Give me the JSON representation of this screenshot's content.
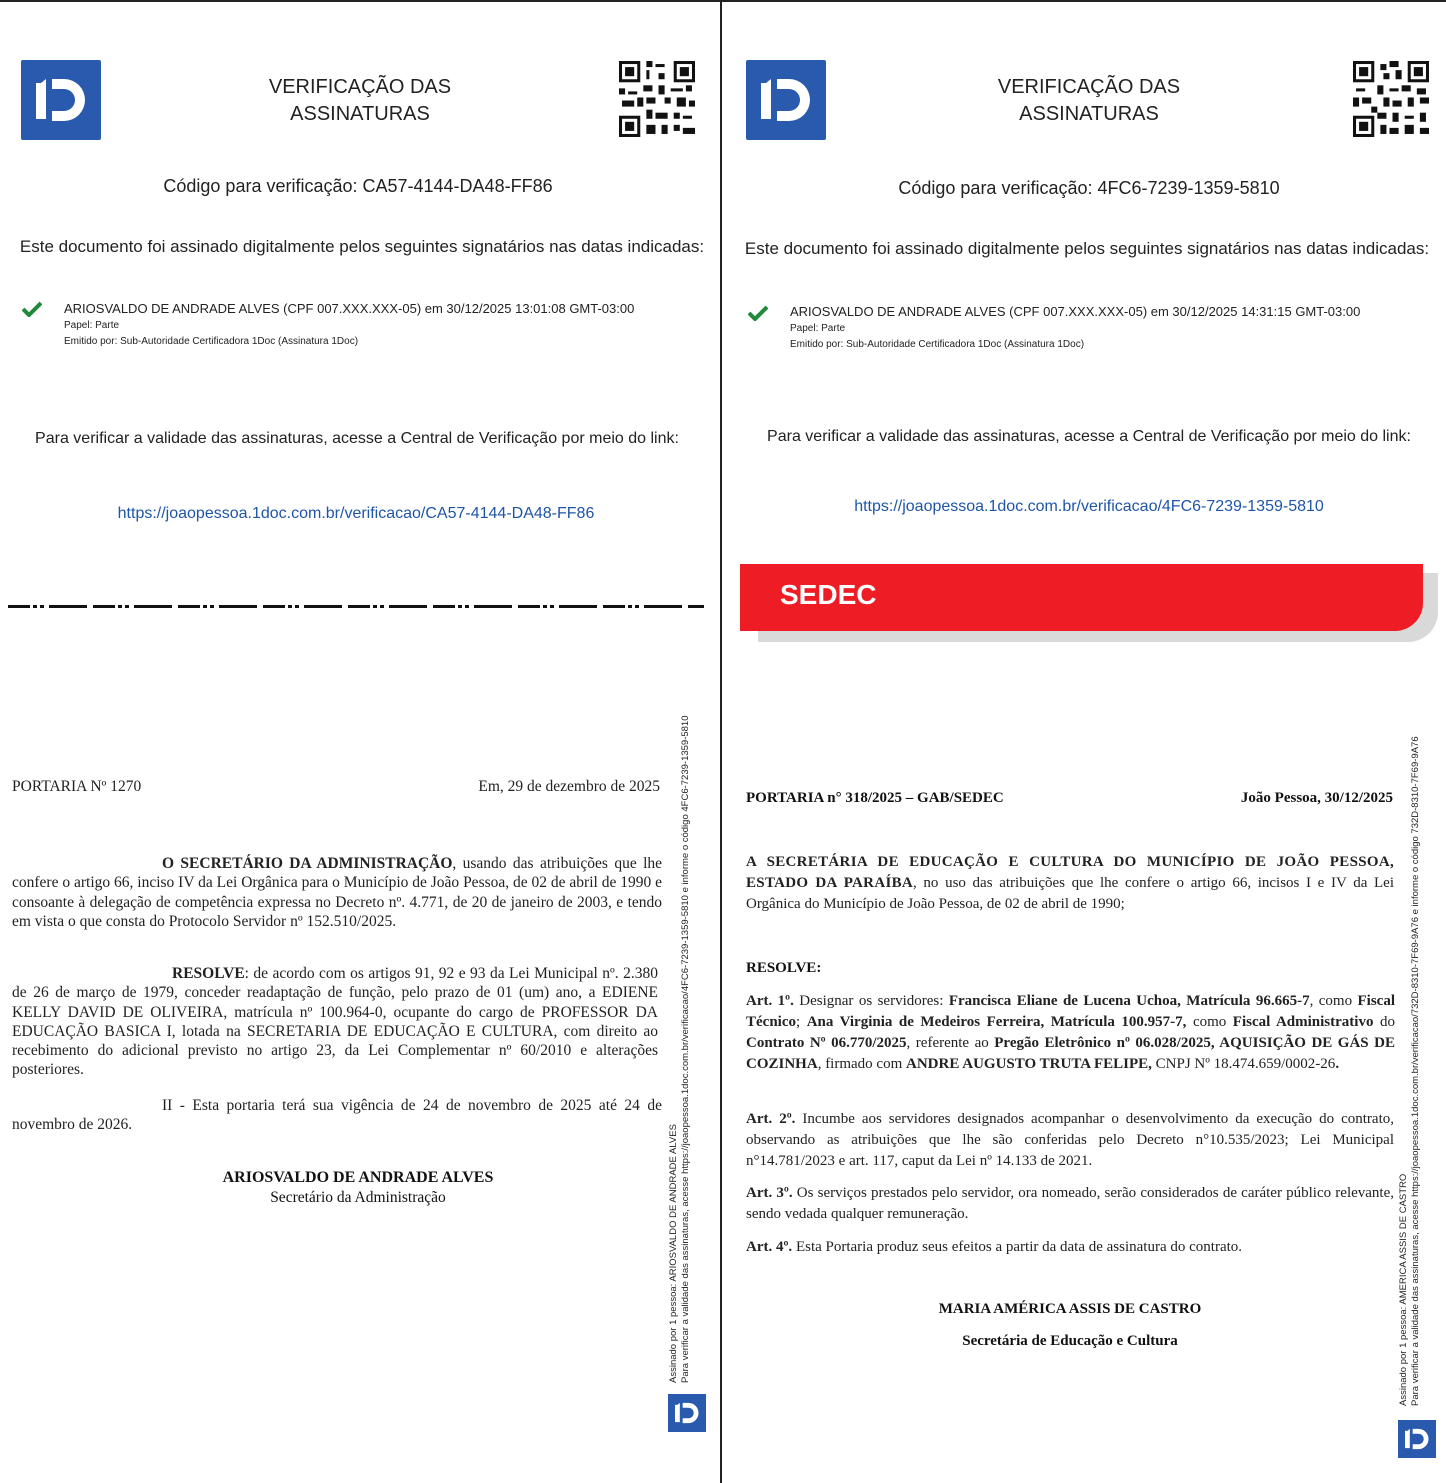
{
  "left": {
    "title_line1": "VERIFICAÇÃO DAS",
    "title_line2": "ASSINATURAS",
    "code_line": "Código para verificação: CA57-4144-DA48-FF86",
    "intro": "Este documento foi assinado digitalmente pelos seguintes signatários nas datas indicadas:",
    "signer": "ARIOSVALDO DE ANDRADE ALVES (CPF 007.XXX.XXX-05) em 30/12/2025 13:01:08 GMT-03:00",
    "role": "Papel: Parte",
    "issuer": "Emitido por: Sub-Autoridade Certificadora 1Doc (Assinatura 1Doc)",
    "verify_text": "Para verificar a validade das assinaturas, acesse a Central de Verificação por meio do link:",
    "link": "https://joaopessoa.1doc.com.br/verificacao/CA57-4144-DA48-FF86",
    "portaria": "PORTARIA Nº 1270",
    "date": "Em, 29 de dezembro de 2025",
    "p1_bold": "O SECRETÁRIO DA ADMINISTRAÇÃO",
    "p1_rest": ", usando das atribuições que lhe confere o artigo 66, inciso IV da Lei Orgânica para o Município de João Pessoa, de 02 de abril de 1990 e consoante à delegação de competência expressa no Decreto nº. 4.771, de 20 de janeiro de 2003, e tendo em vista o que consta do Protocolo Servidor nº 152.510/2025.",
    "p2_bold": "RESOLVE",
    "p2_rest": ": de acordo com os artigos 91, 92 e 93 da Lei Municipal nº. 2.380 de 26 de março de 1979, conceder readaptação de função, pelo prazo de 01 (um) ano, a EDIENE KELLY DAVID DE OLIVEIRA,  matrícula  nº 100.964-0, ocupante do cargo de PROFESSOR DA EDUCAÇÃO BASICA I, lotada na SECRETARIA DE EDUCAÇÃO E CULTURA, com direito ao recebimento do adicional previsto no artigo 23, da Lei Complementar nº 60/2010 e alterações posteriores.",
    "p3": "II - Esta portaria terá sua vigência de 24 de novembro de 2025 até 24 de novembro de 2026.",
    "sign_name": "ARIOSVALDO DE ANDRADE ALVES",
    "sign_title": "Secretário da Administração",
    "side_line1": "Assinado por 1 pessoa:  ARIOSVALDO DE ANDRADE ALVES",
    "side_line2": "Para verificar a validade das assinaturas, acesse https://joaopessoa.1doc.com.br/verificacao/4FC6-7239-1359-5810 e informe o código 4FC6-7239-1359-5810"
  },
  "right": {
    "title_line1": "VERIFICAÇÃO DAS",
    "title_line2": "ASSINATURAS",
    "code_line": "Código para verificação: 4FC6-7239-1359-5810",
    "intro": "Este documento foi assinado digitalmente pelos seguintes signatários nas datas indicadas:",
    "signer": "ARIOSVALDO DE ANDRADE ALVES (CPF 007.XXX.XXX-05) em 30/12/2025 14:31:15 GMT-03:00",
    "role": "Papel: Parte",
    "issuer": "Emitido por: Sub-Autoridade Certificadora 1Doc (Assinatura 1Doc)",
    "verify_text": "Para verificar a validade das assinaturas, acesse a Central de Verificação por meio do link:",
    "link": "https://joaopessoa.1doc.com.br/verificacao/4FC6-7239-1359-5810",
    "banner": "SEDEC",
    "portaria": "PORTARIA n° 318/2025 – GAB/SEDEC",
    "date": "João Pessoa, 30/12/2025",
    "intro_bold": "A SECRETÁRIA DE EDUCAÇÃO E CULTURA DO MUNICÍPIO DE JOÃO PESSOA, ESTADO DA PARAÍBA",
    "intro_rest": ", no uso das atribuições que lhe confere o artigo 66, incisos I e IV da Lei Orgânica do Município de João Pessoa, de 02 de abril de 1990;",
    "resolve": "RESOLVE:",
    "art1_label": "Art. 1º.",
    "art1_a": "  Designar os servidores: ",
    "art1_b": "Francisca Eliane de Lucena Uchoa, Matrícula 96.665-7",
    "art1_c": ", como ",
    "art1_d": "Fiscal Técnico",
    "art1_e": "; ",
    "art1_f": "Ana Virginia de Medeiros Ferreira, Matrícula 100.957-7,",
    "art1_g": " como ",
    "art1_h": "Fiscal Administrativo",
    "art1_i": " do ",
    "art1_j": "Contrato Nº 06.770/2025",
    "art1_k": ", referente ao ",
    "art1_l": "Pregão Eletrônico nº 06.028/2025, AQUISIÇÃO DE GÁS DE COZINHA",
    "art1_m": ", firmado com ",
    "art1_n": "ANDRE AUGUSTO TRUTA FELIPE,",
    "art1_o": " CNPJ Nº 18.474.659/0002-26",
    "art1_p": ".",
    "art2_label": "Art. 2º.",
    "art2": " Incumbe aos servidores designados acompanhar o desenvolvimento da execução do contrato, observando as atribuições que lhe são conferidas pelo Decreto n°10.535/2023; Lei Municipal n°14.781/2023 e art. 117, caput da Lei nº 14.133 de 2021.",
    "art3_label": "Art. 3º.",
    "art3": " Os serviços prestados pelo servidor, ora nomeado, serão considerados de caráter público relevante, sendo vedada qualquer remuneração.",
    "art4_label": "Art. 4º.",
    "art4": " Esta Portaria produz seus efeitos a partir da data de assinatura do contrato.",
    "sign_name": "MARIA AMÉRICA ASSIS DE CASTRO",
    "sign_title": "Secretária de Educação e Cultura",
    "side_line1": "Assinado por 1 pessoa:  AMERICA ASSIS DE CASTRO",
    "side_line2": "Para verificar a validade das assinaturas, acesse https://joaopessoa.1doc.com.br/verificacao/732D-8310-7F69-9A76 e informe o código 732D-8310-7F69-9A76"
  },
  "colors": {
    "brand_blue": "#2a5aad",
    "link_blue": "#1f55a8",
    "check_green": "#1e8a3a",
    "sedec_red": "#ee1c25"
  },
  "icons": [
    "1doc-logo-icon",
    "qr-code-icon",
    "check-icon"
  ]
}
